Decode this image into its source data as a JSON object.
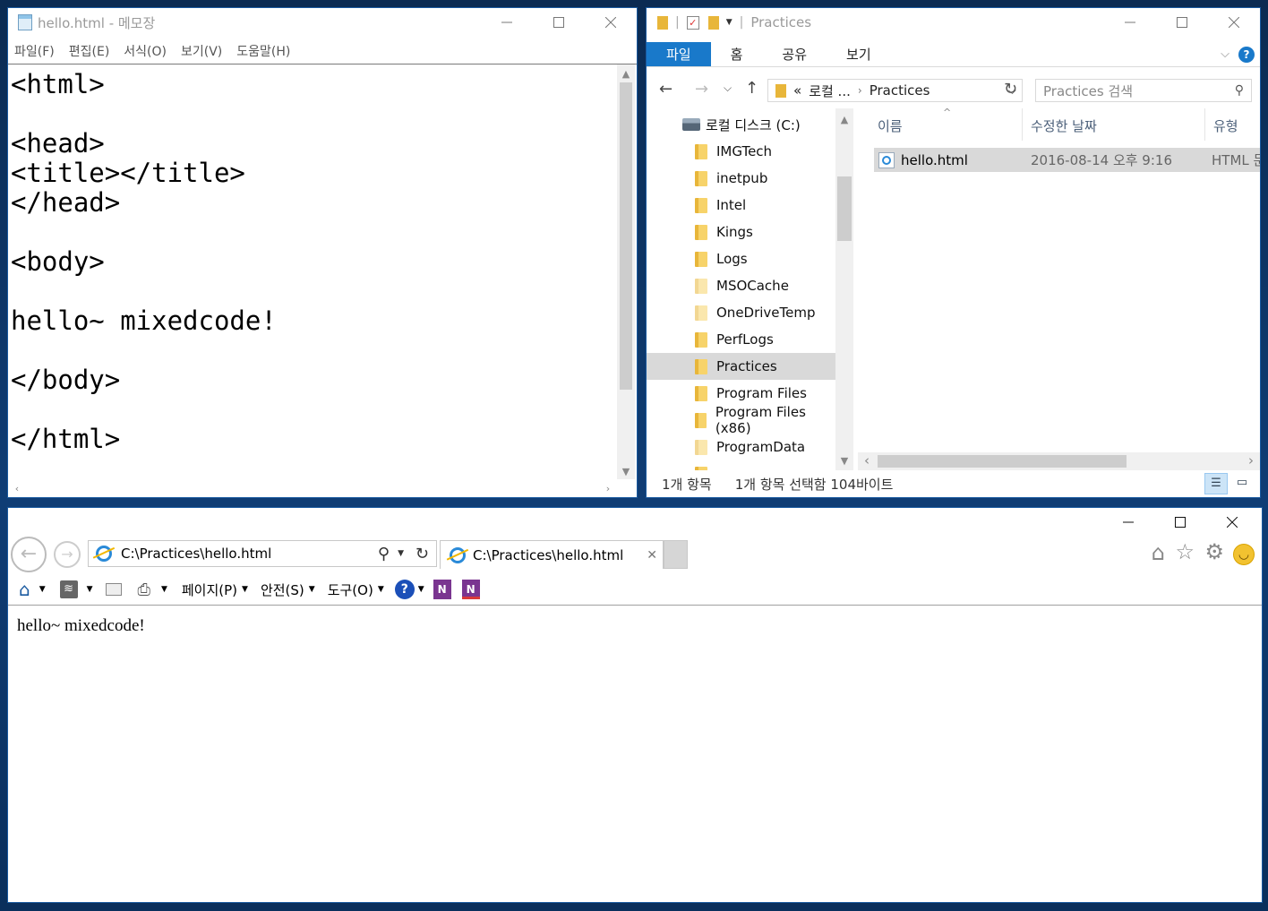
{
  "notepad": {
    "title": "hello.html - 메모장",
    "menu": [
      "파일(F)",
      "편집(E)",
      "서식(O)",
      "보기(V)",
      "도움말(H)"
    ],
    "content": "<html>\n\n<head>\n<title></title>\n</head>\n\n<body>\n\nhello~ mixedcode!\n\n</body>\n\n</html>"
  },
  "explorer": {
    "title": "Practices",
    "ribbon_tabs": [
      "파일",
      "홈",
      "공유",
      "보기"
    ],
    "breadcrumb": [
      "«",
      "로컬 ...",
      "Practices"
    ],
    "search_placeholder": "Practices 검색",
    "tree": {
      "drive": "로컬 디스크 (C:)",
      "folders": [
        "IMGTech",
        "inetpub",
        "Intel",
        "Kings",
        "Logs",
        "MSOCache",
        "OneDriveTemp",
        "PerfLogs",
        "Practices",
        "Program Files",
        "Program Files (x86)",
        "ProgramData"
      ],
      "selected": "Practices"
    },
    "columns": {
      "name": "이름",
      "date": "수정한 날짜",
      "type": "유형"
    },
    "files": [
      {
        "name": "hello.html",
        "date": "2016-08-14 오후 9:16",
        "type": "HTML 문"
      }
    ],
    "status": {
      "count": "1개 항목",
      "selection": "1개 항목 선택함 104바이트"
    }
  },
  "ie": {
    "address": "C:\\Practices\\hello.html",
    "tab_title": "C:\\Practices\\hello.html",
    "commands": [
      "페이지(P)",
      "안전(S)",
      "도구(O)"
    ],
    "page_text": "hello~ mixedcode!"
  }
}
